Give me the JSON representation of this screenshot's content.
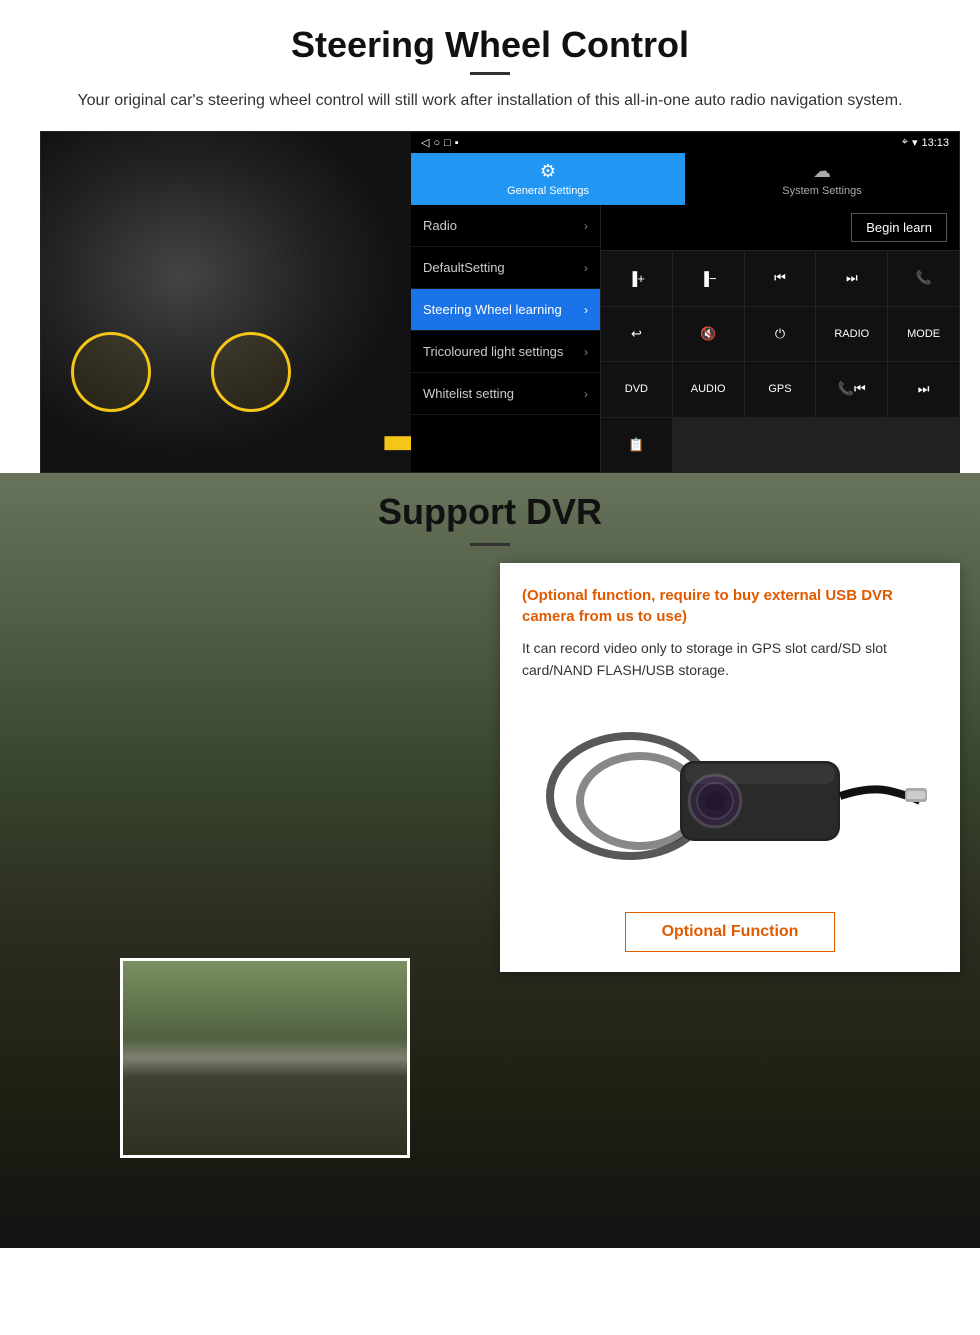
{
  "section1": {
    "title": "Steering Wheel Control",
    "divider": true,
    "subtitle": "Your original car's steering wheel control will still work after installation of this all-in-one auto radio navigation system.",
    "android_ui": {
      "status_bar": {
        "time": "13:13",
        "icons": [
          "▲",
          "◀",
          "○",
          "□",
          "■"
        ]
      },
      "tabs": [
        {
          "label": "General Settings",
          "icon": "⚙",
          "active": true
        },
        {
          "label": "System Settings",
          "icon": "☁",
          "active": false
        }
      ],
      "settings_menu": [
        {
          "label": "Radio",
          "active": false
        },
        {
          "label": "DefaultSetting",
          "active": false
        },
        {
          "label": "Steering Wheel learning",
          "active": true
        },
        {
          "label": "Tricoloured light settings",
          "active": false
        },
        {
          "label": "Whitelist setting",
          "active": false
        }
      ],
      "begin_learn_label": "Begin learn",
      "media_buttons": [
        {
          "label": "▐+",
          "icon": true
        },
        {
          "label": "▐−",
          "icon": true
        },
        {
          "label": "⏮",
          "icon": true
        },
        {
          "label": "⏭",
          "icon": true
        },
        {
          "label": "📞",
          "icon": true
        },
        {
          "label": "↩",
          "icon": true
        },
        {
          "label": "🔇",
          "icon": true
        },
        {
          "label": "⏻",
          "icon": true
        },
        {
          "label": "RADIO",
          "icon": false
        },
        {
          "label": "MODE",
          "icon": false
        },
        {
          "label": "DVD",
          "icon": false
        },
        {
          "label": "AUDIO",
          "icon": false
        },
        {
          "label": "GPS",
          "icon": false
        },
        {
          "label": "📞⏮",
          "icon": false
        },
        {
          "label": "⏭",
          "icon": false
        },
        {
          "label": "📋",
          "icon": false
        }
      ]
    }
  },
  "section2": {
    "title": "Support DVR",
    "card": {
      "optional_text": "(Optional function, require to buy external USB DVR camera from us to use)",
      "desc_text": "It can record video only to storage in GPS slot card/SD slot card/NAND FLASH/USB storage.",
      "optional_function_label": "Optional Function"
    }
  }
}
